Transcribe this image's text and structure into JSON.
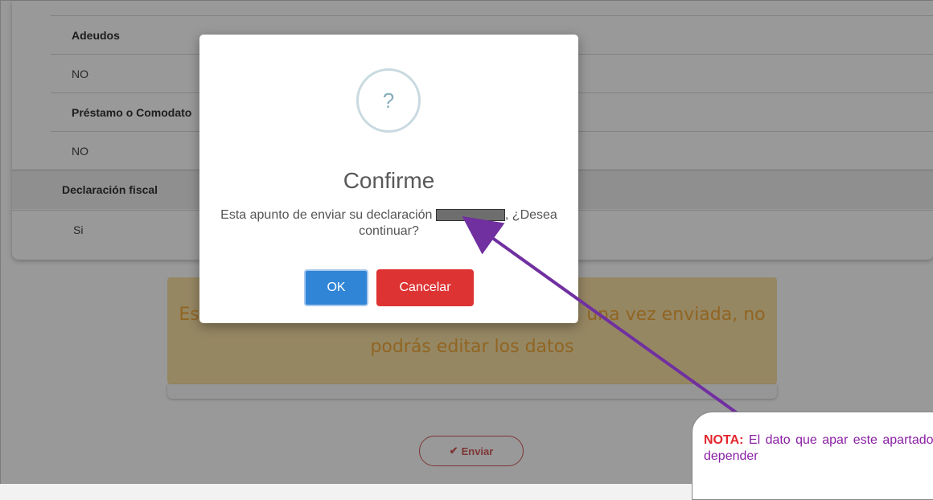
{
  "form": {
    "rows": [
      {
        "label": "Adeudos",
        "value": "NO"
      },
      {
        "label": "Préstamo o Comodato",
        "value": "NO"
      }
    ],
    "section": {
      "title": "Declaración fiscal",
      "value": "Si"
    }
  },
  "warning": {
    "line1": "Estas a punto de enviar la declaración inicial, una vez enviada, no",
    "line2": "podrás editar los datos"
  },
  "send_button": {
    "label": "Enviar",
    "icon": "check-icon"
  },
  "dialog": {
    "icon": "question-icon",
    "icon_glyph": "?",
    "title": "Confirme",
    "text_before": "Esta apunto de enviar su declaración",
    "text_after": ", ¿Desea continuar?",
    "ok_label": "OK",
    "cancel_label": "Cancelar"
  },
  "note": {
    "prefix": "NOTA:",
    "text": "El dato que apar este apartado, depender"
  },
  "colors": {
    "ok": "#3085d6",
    "cancel": "#dd3333",
    "arrow": "#7030a0",
    "warning_bg": "#fbe2a6",
    "warning_text": "#f0a83a"
  }
}
